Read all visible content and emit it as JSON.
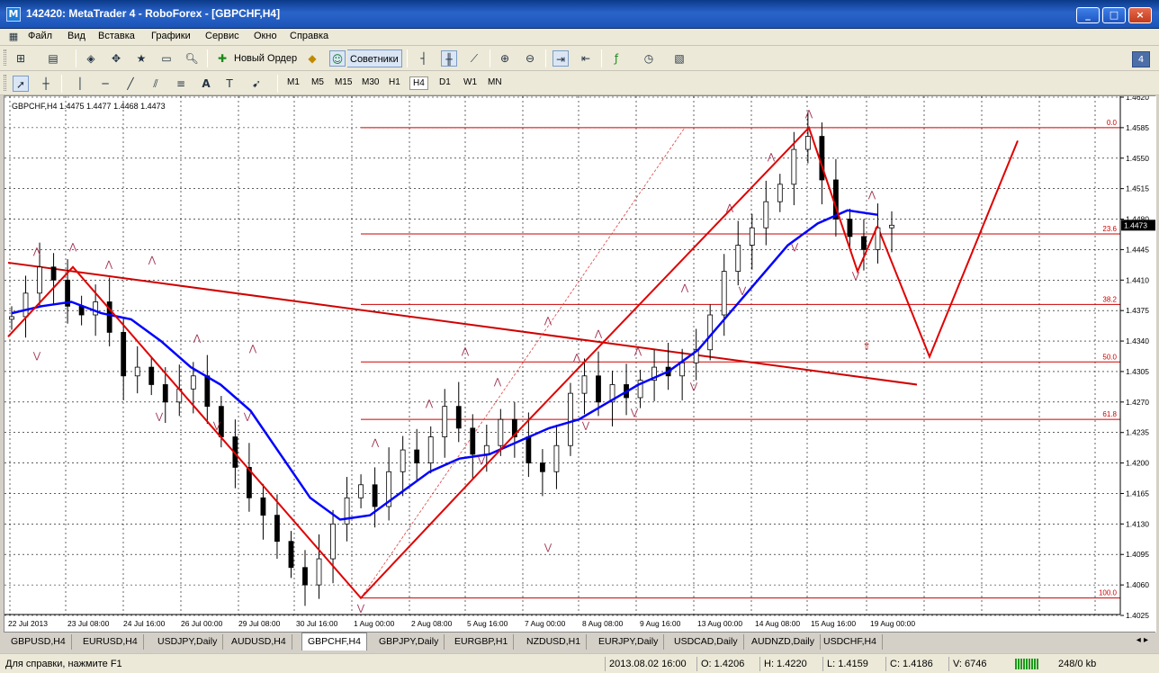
{
  "window": {
    "title": "142420: MetaTrader 4 - RoboForex - [GBPCHF,H4]",
    "app_icon": "metatrader-logo-icon"
  },
  "menu": [
    "Файл",
    "Вид",
    "Вставка",
    "Графики",
    "Сервис",
    "Окно",
    "Справка"
  ],
  "toolbar": {
    "new_order_label": "Новый Ордер",
    "experts_label": "Советники"
  },
  "timeframes": [
    "M1",
    "M5",
    "M15",
    "M30",
    "H1",
    "H4",
    "D1",
    "W1",
    "MN"
  ],
  "active_timeframe": "H4",
  "chart_data": {
    "type": "candlestick",
    "symbol_info": "GBPCHF,H4  1.4475 1.4477 1.4468 1.4473",
    "current_price": "1.4473",
    "ylim": [
      1.4025,
      1.462
    ],
    "y_ticks": [
      "1.4620",
      "1.4585",
      "1.4550",
      "1.4515",
      "1.4480",
      "1.4445",
      "1.4410",
      "1.4375",
      "1.4340",
      "1.4305",
      "1.4270",
      "1.4235",
      "1.4200",
      "1.4165",
      "1.4130",
      "1.4095",
      "1.4060",
      "1.4025"
    ],
    "x_tick_labels": [
      "22 Jul 2013",
      "23 Jul 08:00",
      "24 Jul 16:00",
      "26 Jul 00:00",
      "29 Jul 08:00",
      "30 Jul 16:00",
      "1 Aug 00:00",
      "2 Aug 08:00",
      "5 Aug 16:00",
      "7 Aug 00:00",
      "8 Aug 08:00",
      "9 Aug 16:00",
      "13 Aug 00:00",
      "14 Aug 08:00",
      "15 Aug 16:00",
      "19 Aug 00:00"
    ],
    "fib_levels": [
      {
        "label": "0.0",
        "price": 1.4585
      },
      {
        "label": "23.6",
        "price": 1.4463
      },
      {
        "label": "38.2",
        "price": 1.4382
      },
      {
        "label": "50.0",
        "price": 1.4316
      },
      {
        "label": "61.8",
        "price": 1.425
      },
      {
        "label": "100.0",
        "price": 1.4045
      }
    ],
    "colors": {
      "bull": "#ffffff",
      "bear": "#000000",
      "ma": "#0000ff",
      "zigzag": "#e00000",
      "fib": "#cc0000",
      "fractal": "#a03050",
      "grid": "#000000"
    }
  },
  "tabs": [
    "GBPUSD,H4",
    "EURUSD,H4",
    "USDJPY,Daily",
    "AUDUSD,H4",
    "GBPCHF,H4",
    "GBPJPY,Daily",
    "EURGBP,H1",
    "NZDUSD,H1",
    "EURJPY,Daily",
    "USDCAD,Daily",
    "AUDNZD,Daily",
    "USDCHF,H4"
  ],
  "active_tab": "GBPCHF,H4",
  "status": {
    "help": "Для справки, нажмите F1",
    "datetime": "2013.08.02 16:00",
    "open": "O: 1.4206",
    "high": "H: 1.4220",
    "low": "L: 1.4159",
    "close": "C: 1.4186",
    "volume": "V: 6746",
    "traffic": "248/0 kb"
  }
}
